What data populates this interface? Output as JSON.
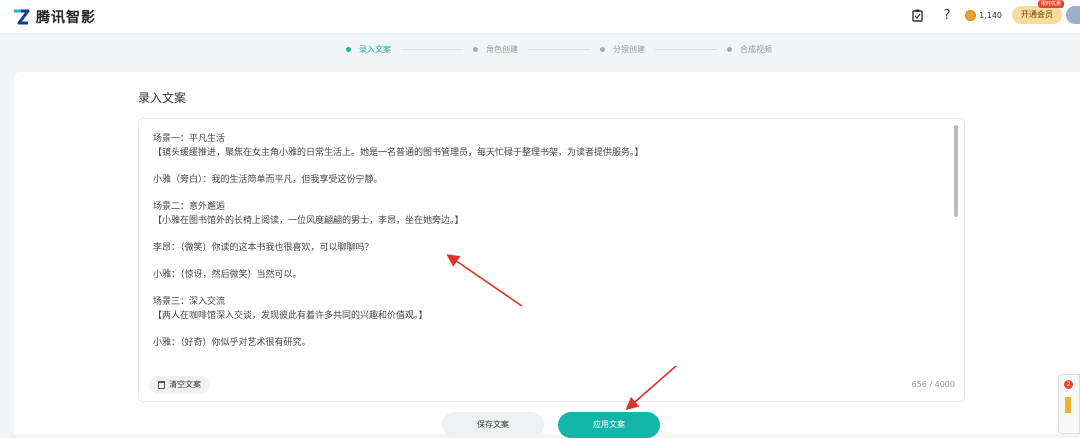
{
  "app": {
    "name": "腾讯智影"
  },
  "topbar": {
    "coins": "1,140",
    "vip_label": "开通会员",
    "vip_tag": "限时优惠"
  },
  "steps": [
    {
      "label": "录入文案",
      "active": true
    },
    {
      "label": "角色创建",
      "active": false
    },
    {
      "label": "分镜创建",
      "active": false
    },
    {
      "label": "合成视频",
      "active": false
    }
  ],
  "section": {
    "title": "录入文案"
  },
  "editor": {
    "text": "场景一：平凡生活\n【镜头缓缓推进，聚焦在女主角小雅的日常生活上。她是一名普通的图书管理员，每天忙碌于整理书架，为读者提供服务。】\n\n小雅（旁白）：我的生活简单而平凡，但我享受这份宁静。\n\n场景二：意外邂逅\n【小雅在图书馆外的长椅上阅读，一位风度翩翩的男士，李昂，坐在她旁边。】\n\n李昂：（微笑）你读的这本书我也很喜欢，可以聊聊吗？\n\n小雅：（惊讶，然后微笑）当然可以。\n\n场景三：深入交流\n【两人在咖啡馆深入交谈，发现彼此有着许多共同的兴趣和价值观。】\n\n小雅：（好奇）你似乎对艺术很有研究。",
    "clear_label": "清空文案",
    "counter": "656 / 4000"
  },
  "actions": {
    "save_label": "保存文案",
    "apply_label": "应用文案"
  },
  "side_widget": {
    "badge": "2"
  },
  "colors": {
    "accent": "#12b5a8",
    "arrow": "#e0302a",
    "vip": "#f7dca0"
  }
}
